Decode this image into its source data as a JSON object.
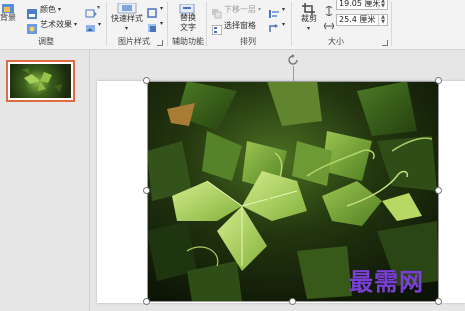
{
  "ribbon": {
    "adjust": {
      "item_partial": "背景",
      "color_label": "颜色",
      "artistic_effects_label": "艺术效果",
      "group_label": "调整"
    },
    "picture_styles": {
      "quick_styles_label": "快速样式",
      "group_label": "图片样式"
    },
    "accessibility": {
      "alt_text_line1": "替换",
      "alt_text_line2": "文字",
      "group_label": "辅助功能"
    },
    "arrange": {
      "send_backward_label": "下移一层",
      "selection_pane_label": "选择窗格",
      "group_label": "排列"
    },
    "size": {
      "crop_label": "裁剪",
      "height_value": "19.05 厘米",
      "width_value": "25.4 厘米",
      "group_label": "大小"
    }
  },
  "thumbnail_pane": {
    "slide_number": "1"
  },
  "watermark": {
    "text": "最需网"
  },
  "colors": {
    "thumbnail_selection": "#e06a44",
    "watermark": "#7a3fd6"
  }
}
